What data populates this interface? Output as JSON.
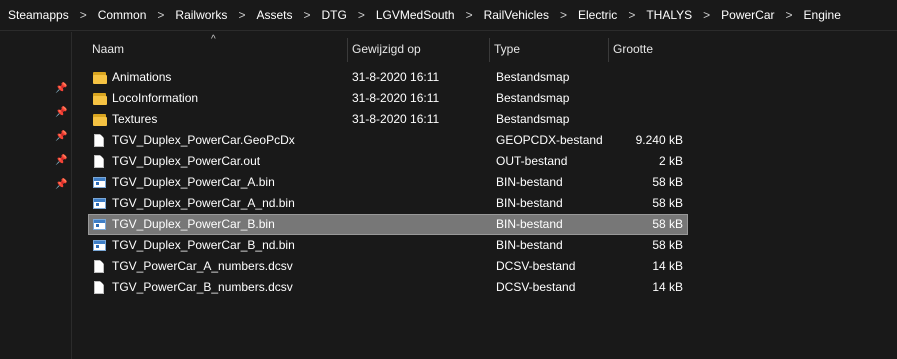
{
  "breadcrumb": [
    "Steamapps",
    "Common",
    "Railworks",
    "Assets",
    "DTG",
    "LGVMedSouth",
    "RailVehicles",
    "Electric",
    "THALYS",
    "PowerCar",
    "Engine"
  ],
  "breadcrumb_separator": ">",
  "columns": {
    "name": "Naam",
    "modified": "Gewijzigd op",
    "type": "Type",
    "size": "Grootte"
  },
  "sort_indicator": "^",
  "pin_glyph": "📌",
  "files": [
    {
      "name": "Animations",
      "modified": "31-8-2020 16:11",
      "type": "Bestandsmap",
      "size": "",
      "icon": "folder-icon"
    },
    {
      "name": "LocoInformation",
      "modified": "31-8-2020 16:11",
      "type": "Bestandsmap",
      "size": "",
      "icon": "folder-icon"
    },
    {
      "name": "Textures",
      "modified": "31-8-2020 16:11",
      "type": "Bestandsmap",
      "size": "",
      "icon": "folder-icon"
    },
    {
      "name": "TGV_Duplex_PowerCar.GeoPcDx",
      "modified": "",
      "type": "GEOPCDX-bestand",
      "size": "9.240 kB",
      "icon": "file-icon"
    },
    {
      "name": "TGV_Duplex_PowerCar.out",
      "modified": "",
      "type": "OUT-bestand",
      "size": "2 kB",
      "icon": "file-icon"
    },
    {
      "name": "TGV_Duplex_PowerCar_A.bin",
      "modified": "",
      "type": "BIN-bestand",
      "size": "58 kB",
      "icon": "bin-file-icon"
    },
    {
      "name": "TGV_Duplex_PowerCar_A_nd.bin",
      "modified": "",
      "type": "BIN-bestand",
      "size": "58 kB",
      "icon": "bin-file-icon"
    },
    {
      "name": "TGV_Duplex_PowerCar_B.bin",
      "modified": "",
      "type": "BIN-bestand",
      "size": "58 kB",
      "icon": "bin-file-icon",
      "selected": true
    },
    {
      "name": "TGV_Duplex_PowerCar_B_nd.bin",
      "modified": "",
      "type": "BIN-bestand",
      "size": "58 kB",
      "icon": "bin-file-icon"
    },
    {
      "name": "TGV_PowerCar_A_numbers.dcsv",
      "modified": "",
      "type": "DCSV-bestand",
      "size": "14 kB",
      "icon": "file-icon"
    },
    {
      "name": "TGV_PowerCar_B_numbers.dcsv",
      "modified": "",
      "type": "DCSV-bestand",
      "size": "14 kB",
      "icon": "file-icon"
    }
  ],
  "colors": {
    "background": "#191919",
    "selection": "#777777",
    "folder": "#f6c343"
  }
}
